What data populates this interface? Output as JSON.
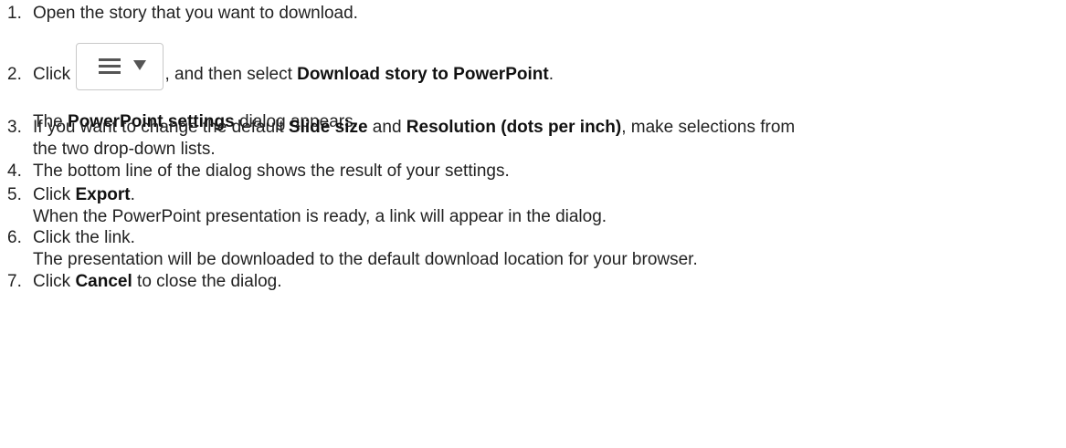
{
  "steps": [
    {
      "number": "1.",
      "lines": [
        [
          {
            "t": "Open the story that you want to download.",
            "b": false
          }
        ]
      ]
    },
    {
      "number": "2.",
      "lines": [
        [
          {
            "t": "Click ",
            "b": false
          },
          {
            "icon": "menu-button"
          },
          {
            "t": ", and then select ",
            "b": false
          },
          {
            "t": "Download story to PowerPoint",
            "b": true
          },
          {
            "t": ".",
            "b": false
          }
        ],
        [
          {
            "t": "The ",
            "b": false
          },
          {
            "t": "PowerPoint settings",
            "b": true
          },
          {
            "t": " dialog appears.",
            "b": false
          }
        ]
      ]
    },
    {
      "number": "3.",
      "lines": [
        [
          {
            "t": "If you want to change the default ",
            "b": false
          },
          {
            "t": "Slide size",
            "b": true
          },
          {
            "t": " and ",
            "b": false
          },
          {
            "t": "Resolution (dots per inch)",
            "b": true
          },
          {
            "t": ", make selections from",
            "b": false
          }
        ],
        [
          {
            "t": "the two drop-down lists.",
            "b": false
          }
        ]
      ]
    },
    {
      "number": "4.",
      "lines": [
        [
          {
            "t": "The bottom line of the dialog shows the result of your settings.",
            "b": false
          }
        ]
      ]
    },
    {
      "number": "5.",
      "lines": [
        [
          {
            "t": "Click ",
            "b": false
          },
          {
            "t": "Export",
            "b": true
          },
          {
            "t": ".",
            "b": false
          }
        ],
        [
          {
            "t": "When the PowerPoint presentation is ready, a link will appear in the dialog.",
            "b": false
          }
        ]
      ]
    },
    {
      "number": "6.",
      "lines": [
        [
          {
            "t": "Click the link.",
            "b": false
          }
        ],
        [
          {
            "t": "The presentation will be downloaded to the default download location for your browser.",
            "b": false
          }
        ]
      ]
    },
    {
      "number": "7.",
      "lines": [
        [
          {
            "t": "Click ",
            "b": false
          },
          {
            "t": "Cancel",
            "b": true
          },
          {
            "t": " to close the dialog.",
            "b": false
          }
        ]
      ]
    }
  ],
  "menu_button": {
    "icon": "hamburger-icon",
    "caret": "caret-down-icon"
  }
}
